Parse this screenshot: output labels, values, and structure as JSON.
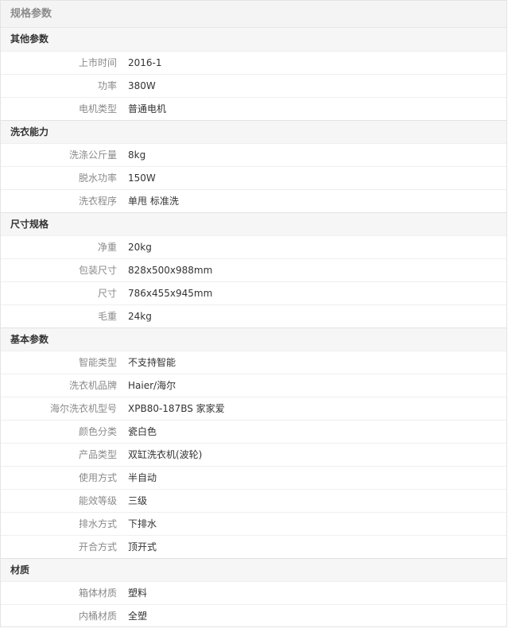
{
  "panel": {
    "title": "规格参数"
  },
  "groups": [
    {
      "name": "其他参数",
      "rows": [
        {
          "key": "上市时间",
          "value": "2016-1"
        },
        {
          "key": "功率",
          "value": "380W"
        },
        {
          "key": "电机类型",
          "value": "普通电机"
        }
      ]
    },
    {
      "name": "洗衣能力",
      "rows": [
        {
          "key": "洗涤公斤量",
          "value": "8kg"
        },
        {
          "key": "脱水功率",
          "value": "150W"
        },
        {
          "key": "洗衣程序",
          "value": "单甩 标准洗"
        }
      ]
    },
    {
      "name": "尺寸规格",
      "rows": [
        {
          "key": "净重",
          "value": "20kg"
        },
        {
          "key": "包装尺寸",
          "value": "828x500x988mm"
        },
        {
          "key": "尺寸",
          "value": "786x455x945mm"
        },
        {
          "key": "毛重",
          "value": "24kg"
        }
      ]
    },
    {
      "name": "基本参数",
      "rows": [
        {
          "key": "智能类型",
          "value": "不支持智能"
        },
        {
          "key": "洗衣机品牌",
          "value": "Haier/海尔"
        },
        {
          "key": "海尔洗衣机型号",
          "value": "XPB80-187BS 家家爱"
        },
        {
          "key": "颜色分类",
          "value": "瓷白色"
        },
        {
          "key": "产品类型",
          "value": "双缸洗衣机(波轮)"
        },
        {
          "key": "使用方式",
          "value": "半自动"
        },
        {
          "key": "能效等级",
          "value": "三级"
        },
        {
          "key": "排水方式",
          "value": "下排水"
        },
        {
          "key": "开合方式",
          "value": "顶开式"
        }
      ]
    },
    {
      "name": "材质",
      "rows": [
        {
          "key": "箱体材质",
          "value": "塑料"
        },
        {
          "key": "内桶材质",
          "value": "全塑"
        }
      ]
    }
  ]
}
